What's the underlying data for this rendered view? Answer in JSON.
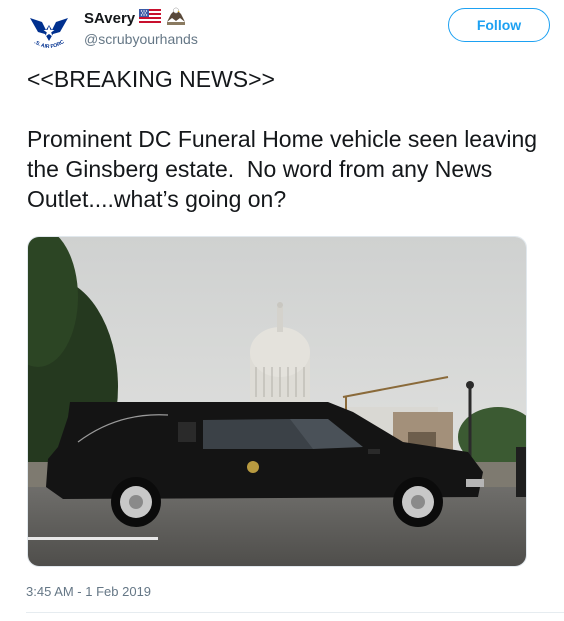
{
  "user": {
    "display_name": "SAvery",
    "handle": "@scrubyourhands",
    "avatar_text": "U.S. AIR FORCE",
    "emojis": [
      "us-flag-icon",
      "eagle-icon"
    ]
  },
  "follow_label": "Follow",
  "tweet": {
    "text": "<<BREAKING NEWS>>\n\nProminent DC Funeral Home vehicle seen leaving the Ginsberg estate.  No word from any News Outlet....what’s going on?"
  },
  "timestamp": "3:45 AM - 1 Feb 2019",
  "colors": {
    "accent": "#1da1f2",
    "secondary_text": "#657786",
    "air_force_blue": "#00308f"
  }
}
